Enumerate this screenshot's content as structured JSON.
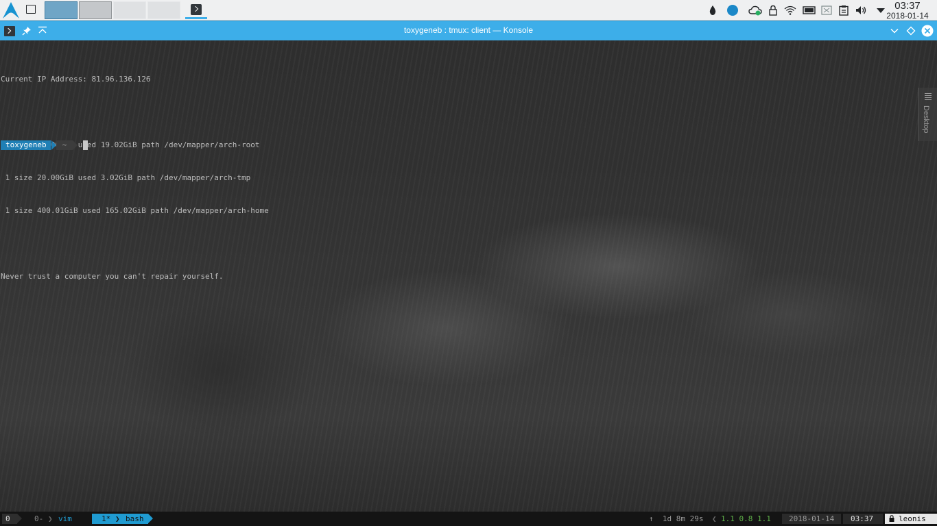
{
  "panel": {
    "launcher_icon": "arch-linux-logo-icon",
    "pager_desktops": 4,
    "task_icon": "konsole-icon",
    "tray_icons": [
      "ink-drop-icon",
      "cloud-sync-icon",
      "dropbox-dot-icon",
      "cloud-check-icon",
      "lock-icon",
      "wifi-icon",
      "battery-icon",
      "disabled-box-icon",
      "clipboard-icon",
      "volume-icon",
      "expand-tray-arrow-icon"
    ],
    "clock": {
      "time": "03:37",
      "date": "2018-01-14"
    }
  },
  "window": {
    "title": "toxygeneb : tmux: client — Konsole",
    "titlebar_color": "#3daee9"
  },
  "terminal": {
    "lines": [
      "Current IP Address: 81.96.136.126",
      "",
      " 1 size 37.00GiB used 19.02GiB path /dev/mapper/arch-root",
      " 1 size 20.00GiB used 3.02GiB path /dev/mapper/arch-tmp",
      " 1 size 400.01GiB used 165.02GiB path /dev/mapper/arch-home",
      "",
      "Never trust a computer you can't repair yourself."
    ],
    "prompt": {
      "user": "toxygeneb",
      "dir": "~"
    }
  },
  "desktop_tab": {
    "label": "Desktop"
  },
  "tmux": {
    "session": "0",
    "windows": [
      {
        "index": "0-",
        "name": "vim",
        "active": false
      },
      {
        "index": "1*",
        "name": "bash",
        "active": true
      }
    ],
    "uptime": "↑  1d 8m 29s",
    "load": "1.1 0.8 1.1",
    "date": "2018-01-14",
    "time": "03:37",
    "host": "leonis"
  }
}
